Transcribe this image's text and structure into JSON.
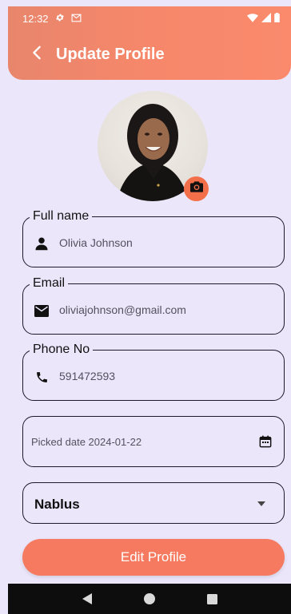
{
  "status_bar": {
    "time": "12:32"
  },
  "app_bar": {
    "title": "Update Profile"
  },
  "profile": {
    "full_name_label": "Full name",
    "full_name_value": "Olivia Johnson",
    "email_label": "Email",
    "email_value": "oliviajohnson@gmail.com",
    "phone_label": "Phone No",
    "phone_value": "591472593",
    "date_text": "Picked date 2024-01-22",
    "city_value": "Nablus"
  },
  "actions": {
    "edit_label": "Edit Profile"
  },
  "colors": {
    "accent": "#f57a5f",
    "background": "#ece6fb",
    "appbar_gradient_start": "#e8866c",
    "appbar_gradient_end": "#fb8a6d"
  },
  "icons": {
    "status": [
      "settings-icon",
      "mail-icon",
      "wifi-icon",
      "signal-icon",
      "battery-icon"
    ],
    "fields": [
      "person-icon",
      "email-icon",
      "phone-icon",
      "calendar-icon"
    ],
    "nav": [
      "back-triangle-icon",
      "home-circle-icon",
      "recents-square-icon"
    ]
  }
}
